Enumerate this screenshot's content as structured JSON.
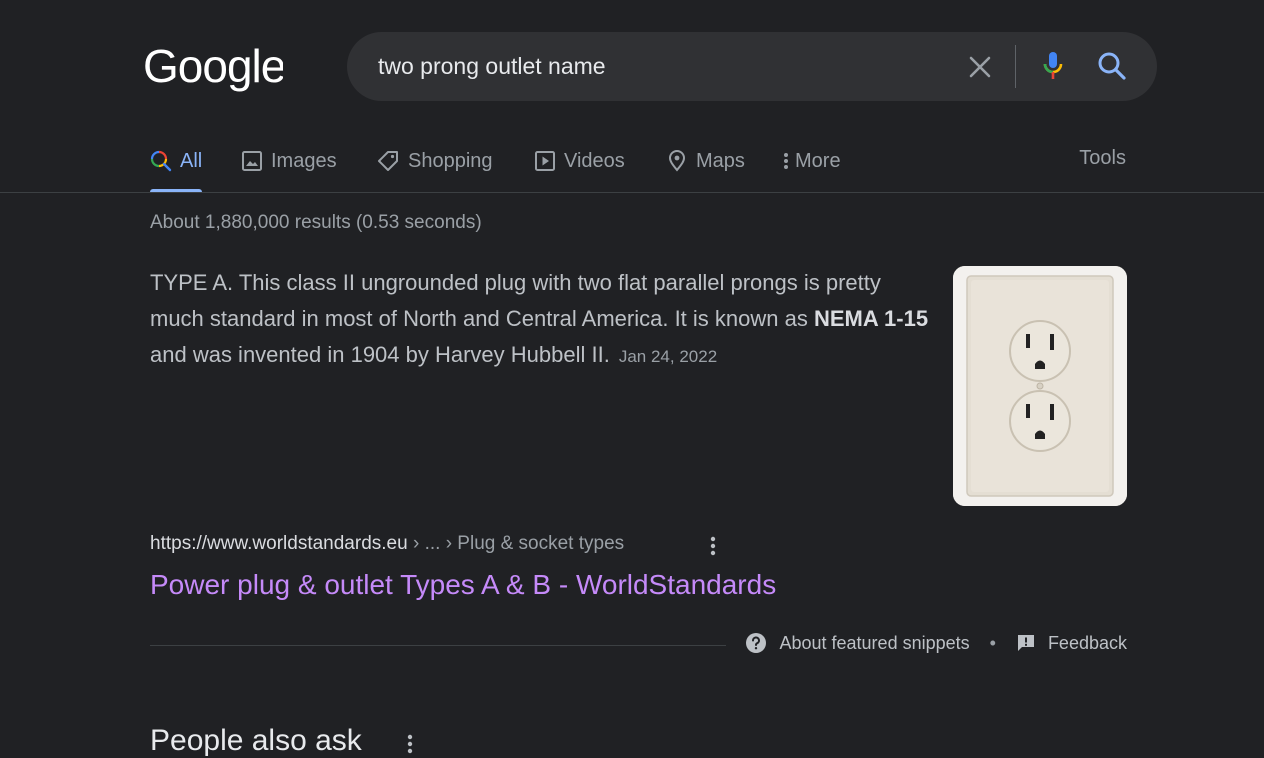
{
  "logo": {
    "text": "Google"
  },
  "search": {
    "query": "two prong outlet name"
  },
  "tabs": [
    {
      "label": "All",
      "icon": "search-multicolor-icon"
    },
    {
      "label": "Images",
      "icon": "image-icon"
    },
    {
      "label": "Shopping",
      "icon": "tag-icon"
    },
    {
      "label": "Videos",
      "icon": "play-icon"
    },
    {
      "label": "Maps",
      "icon": "map-pin-icon"
    },
    {
      "label": "More",
      "icon": "vertical-dots-icon"
    }
  ],
  "tools_label": "Tools",
  "result_stats": "About 1,880,000 results (0.53 seconds)",
  "featured_snippet": {
    "text_before": "TYPE A. This class II ungrounded plug with two flat parallel prongs is pretty much standard in most of North and Central America. It is known as ",
    "bold": "NEMA 1-15",
    "text_after": " and was invented in 1904 by Harvey Hubbell II.",
    "date": "Jan 24, 2022",
    "image_icon": "electrical-outlet-photo"
  },
  "result": {
    "domain": "https://www.worldstandards.eu",
    "path": " › ... › Plug & socket types",
    "title": "Power plug & outlet Types A & B - WorldStandards"
  },
  "footer": {
    "about_label": "About featured snippets",
    "separator": "•",
    "feedback_label": "Feedback"
  },
  "people_also_ask": "People also ask",
  "colors": {
    "background": "#202124",
    "link_visited": "#c58af9",
    "active_tab": "#8ab4f8"
  }
}
